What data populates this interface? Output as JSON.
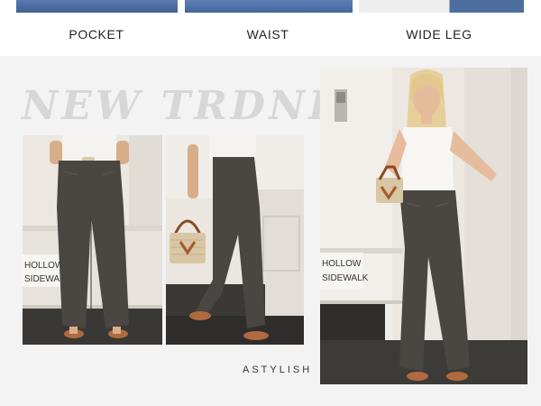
{
  "features": [
    {
      "label": "POCKET"
    },
    {
      "label": "WAIST"
    },
    {
      "label": "WIDE LEG"
    }
  ],
  "headline": "NEW TRDND",
  "sign_text": [
    "HOLLOW",
    "SIDEWALK"
  ],
  "brand": "ASTYLISH",
  "colors": {
    "denim_blue": "#4e6f9e",
    "jeans_gray": "#4a4642",
    "wall": "#ebe7e0",
    "background": "#f3f3f3",
    "headline": "#d7d7d7"
  }
}
